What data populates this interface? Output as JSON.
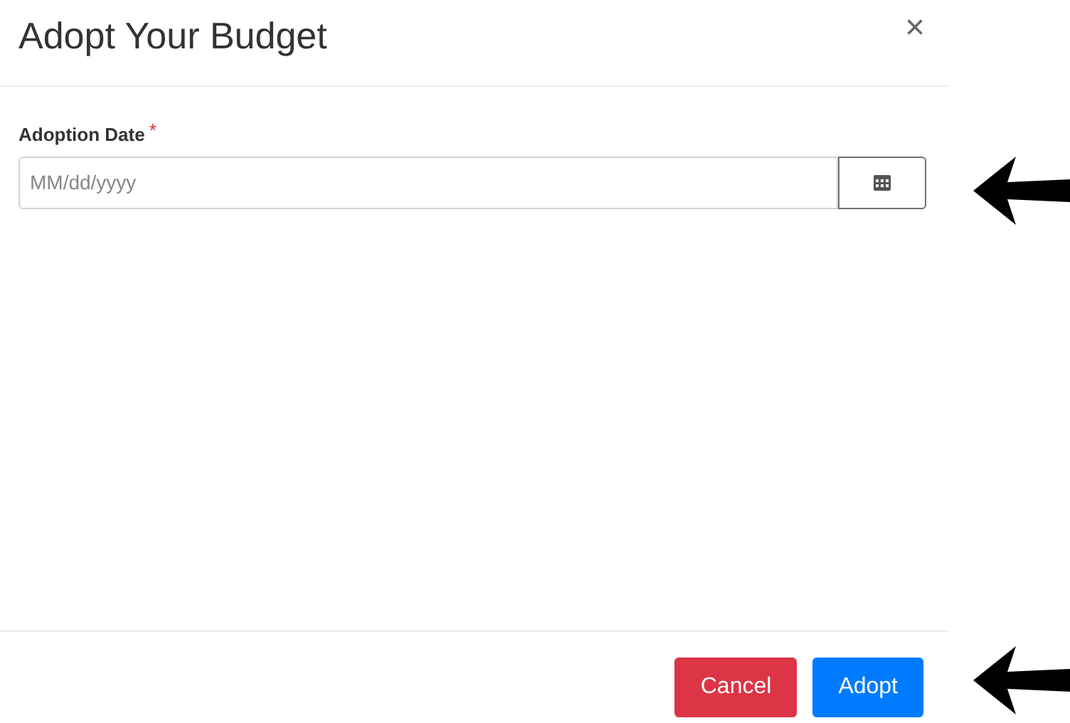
{
  "dialog": {
    "title": "Adopt Your Budget",
    "close": "×"
  },
  "field": {
    "label": "Adoption Date",
    "required_mark": "*",
    "placeholder": "MM/dd/yyyy"
  },
  "buttons": [
    {
      "label": "Cancel",
      "kind": "danger"
    },
    {
      "label": "Adopt",
      "kind": "primary"
    }
  ]
}
